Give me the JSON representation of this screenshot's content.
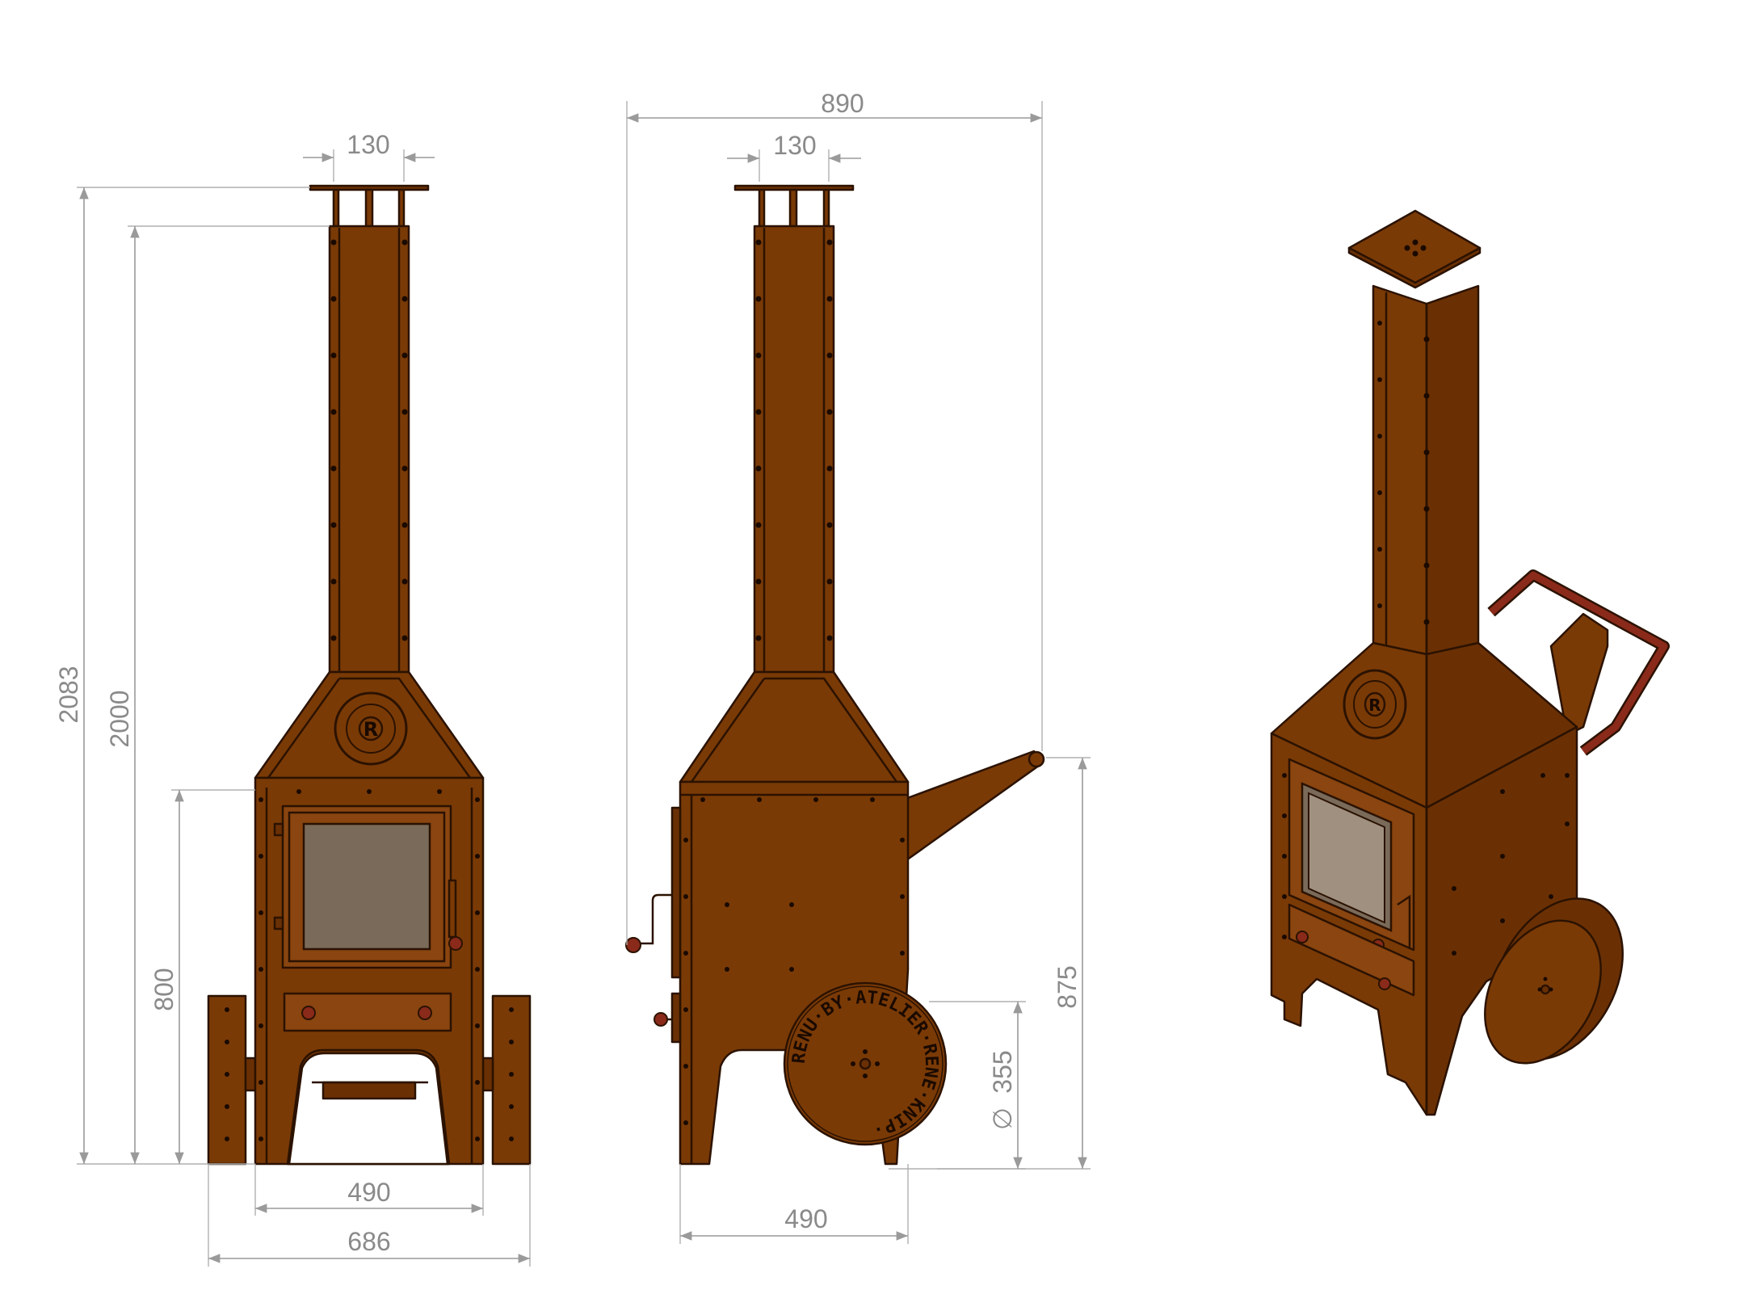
{
  "front_view": {
    "dim_top_width": "130",
    "dim_total_height": "2083",
    "dim_chimney_height": "2000",
    "dim_door_height": "800",
    "dim_body_width": "490",
    "dim_overall_width": "686",
    "logo_letter": "R"
  },
  "side_view": {
    "dim_overall_depth": "890",
    "dim_top_width": "130",
    "dim_handle_height": "875",
    "dim_wheel_diameter": "355",
    "dim_body_depth": "490",
    "wheel_lettering": "RENU·BY·ATELIER·RENE·KNIP·"
  },
  "iso_view": {
    "logo_letter": "R"
  },
  "colors": {
    "steel": "#7a3a06",
    "outline": "#2b1200",
    "dimension": "#9a9a9a",
    "handle": "#8a2a1a"
  }
}
